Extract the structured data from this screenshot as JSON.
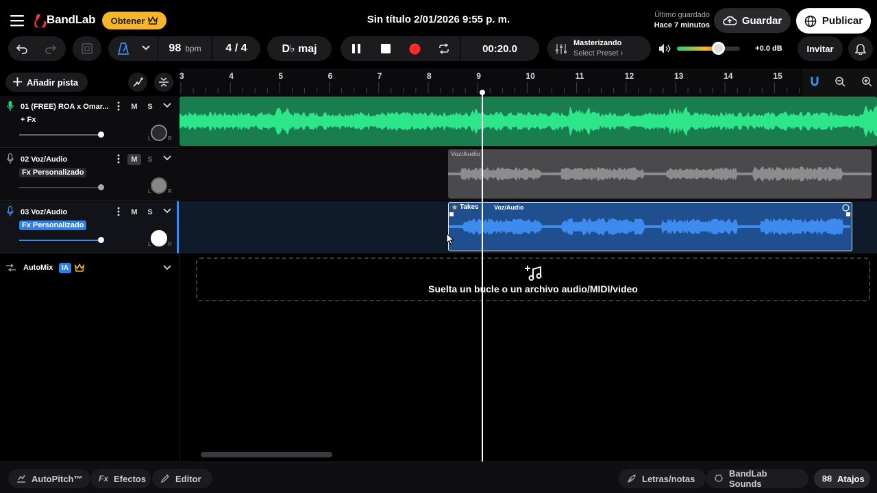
{
  "header": {
    "brand": "BandLab",
    "obtener_label": "Obtener",
    "title": "Sin título 2/01/2026 9:55 p. m.",
    "saved_label": "Último guardado",
    "saved_time": "Hace 7 minutos",
    "guardar_label": "Guardar",
    "publicar_label": "Publicar"
  },
  "transport": {
    "bpm": "98",
    "bpm_unit": "bpm",
    "time_sig": "4 / 4",
    "key": "D♭ maj",
    "time": "00:20.0",
    "master_label": "Masterizando",
    "master_preset": "Select Preset ›",
    "volume_db": "+0.0 dB",
    "volume_level": 0.65,
    "invitar_label": "Invitar"
  },
  "left_panel": {
    "add_track": "Añadir pista",
    "automix_label": "AutoMix",
    "ia_badge": "IA"
  },
  "tracks": [
    {
      "name": "01  (FREE) ROA x Omar...",
      "fx": "+ Fx",
      "m": "M",
      "s": "S",
      "color": "#21d07a",
      "l": "L",
      "r": "R"
    },
    {
      "name": "02  Voz/Audio",
      "fx": "Fx Personalizado",
      "m": "M",
      "s": "S",
      "color": "#8a8a8a",
      "l": "L",
      "r": "R"
    },
    {
      "name": "03  Voz/Audio",
      "fx": "Fx Personalizado",
      "m": "M",
      "s": "S",
      "color": "#3d8bef",
      "l": "L",
      "r": "R"
    }
  ],
  "ruler": {
    "bars": [
      "3",
      "4",
      "5",
      "6",
      "7",
      "8",
      "9",
      "10",
      "11",
      "12",
      "13",
      "14",
      "15"
    ]
  },
  "clips": {
    "clip2_label": "Voz/Audio",
    "clip3_takes": "Takes",
    "clip3_label": "Voz/Audio"
  },
  "dropzone": {
    "text": "Suelta un bucle o un archivo audio/MIDI/video"
  },
  "bottom": {
    "autopitch": "AutoPitch™",
    "efectos": "Efectos",
    "editor": "Editor",
    "letras": "Letras/notas",
    "sounds": "BandLab Sounds",
    "atajos": "Atajos"
  },
  "colors": {
    "accent_yellow": "#f5b62a",
    "track1_green": "#21d07a",
    "track3_blue": "#3d8bef",
    "record_red": "#ff2a2a"
  }
}
